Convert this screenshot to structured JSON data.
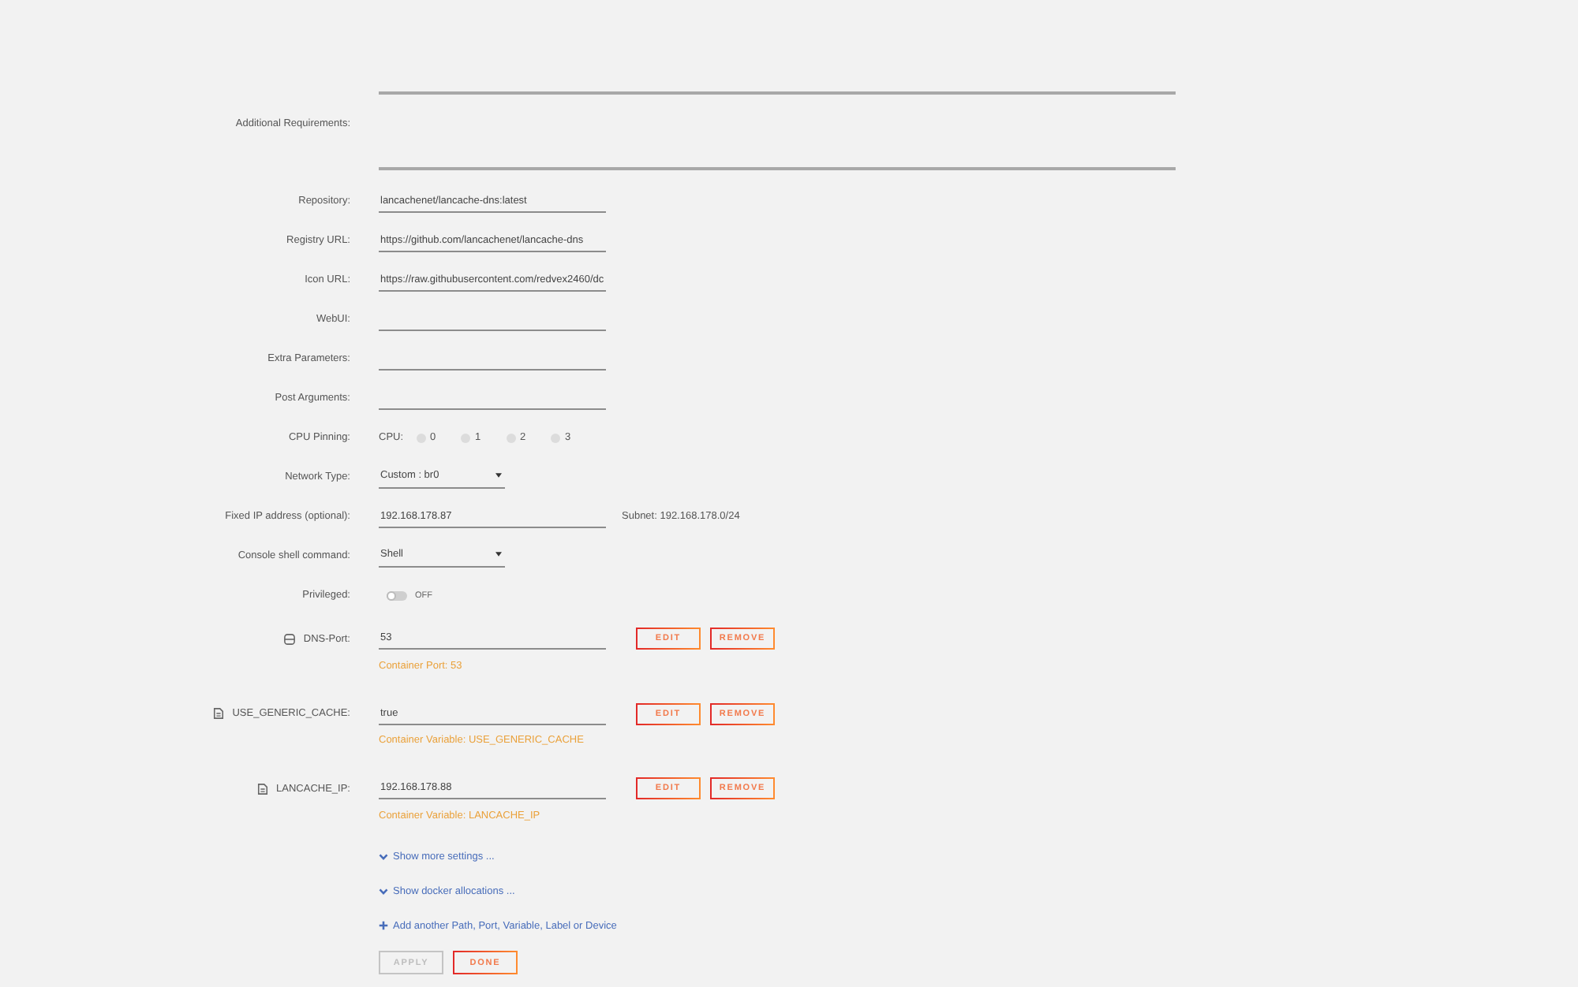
{
  "form": {
    "fields": [
      {
        "kind": "textarea"
      },
      {
        "kind": "textarea",
        "label": "Additional Requirements:"
      },
      {
        "kind": "text",
        "label": "Repository:",
        "value": "lancachenet/lancache-dns:latest"
      },
      {
        "kind": "text",
        "label": "Registry URL:",
        "value": "https://github.com/lancachenet/lancache-dns"
      },
      {
        "kind": "text",
        "label": "Icon URL:",
        "value": "https://raw.githubusercontent.com/redvex2460/dc"
      },
      {
        "kind": "text",
        "label": "WebUI:"
      },
      {
        "kind": "text",
        "label": "Extra Parameters:"
      },
      {
        "kind": "text",
        "label": "Post Arguments:"
      },
      {
        "kind": "cpu",
        "label": "CPU Pinning:",
        "prefix": "CPU:",
        "cpus": [
          {
            "label": "0",
            "checked": false
          },
          {
            "label": "1",
            "checked": false
          },
          {
            "label": "2",
            "checked": false
          },
          {
            "label": "3",
            "checked": false
          }
        ]
      },
      {
        "kind": "select",
        "label": "Network Type:",
        "value": "Custom : br0"
      },
      {
        "kind": "text",
        "label": "Fixed IP address (optional):",
        "value": "192.168.178.87",
        "note": "Subnet: 192.168.178.0/24"
      },
      {
        "kind": "select",
        "label": "Console shell command:",
        "value": "Shell"
      },
      {
        "kind": "toggle",
        "label": "Privileged:",
        "on": false,
        "state_label": "OFF"
      }
    ]
  },
  "config_items": [
    {
      "kind": "port",
      "label": "DNS-Port:",
      "value": "53",
      "description": "Container Port: 53",
      "buttons": [
        "EDIT",
        "REMOVE"
      ]
    },
    {
      "kind": "variable",
      "label": "USE_GENERIC_CACHE:",
      "value": "true",
      "description": "Container Variable: USE_GENERIC_CACHE",
      "buttons": [
        "EDIT",
        "REMOVE"
      ]
    },
    {
      "kind": "variable",
      "label": "LANCACHE_IP:",
      "value": "192.168.178.88",
      "description": "Container Variable: LANCACHE_IP",
      "buttons": [
        "EDIT",
        "REMOVE"
      ]
    }
  ],
  "links": [
    {
      "kind": "expand",
      "label": "Show more settings ..."
    },
    {
      "kind": "expand",
      "label": "Show docker allocations ..."
    },
    {
      "kind": "add",
      "label": "Add another Path, Port, Variable, Label or Device"
    }
  ],
  "actions": [
    {
      "label": "APPLY",
      "disabled": true
    },
    {
      "label": "DONE",
      "disabled": false
    }
  ]
}
